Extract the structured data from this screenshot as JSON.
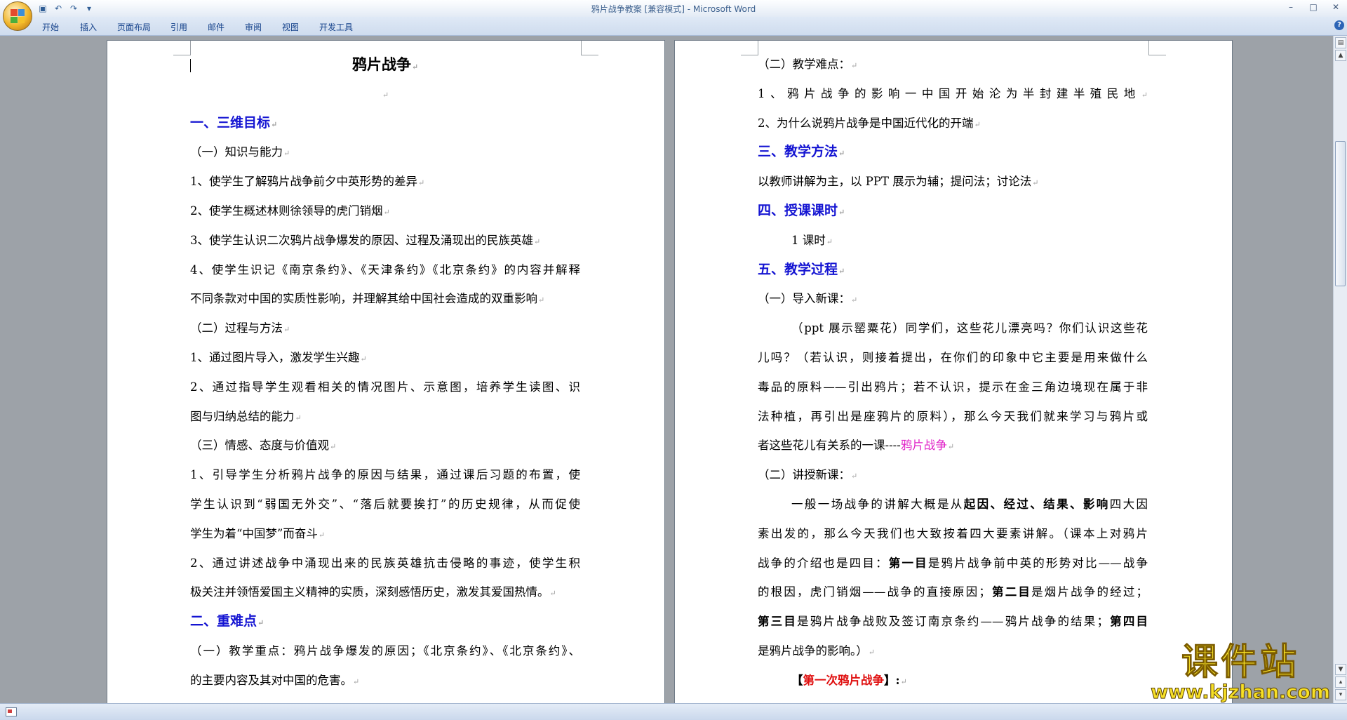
{
  "window": {
    "title": "鸦片战争教案 [兼容模式] - Microsoft Word",
    "controls": {
      "minimize": "–",
      "maximize": "□",
      "close": "✕"
    }
  },
  "qat": {
    "save_icon": "save-icon",
    "undo_icon": "undo-icon",
    "redo_icon": "redo-icon",
    "customize_icon": "chevron-down-icon"
  },
  "ribbon": {
    "tabs": [
      "开始",
      "插入",
      "页面布局",
      "引用",
      "邮件",
      "审阅",
      "视图",
      "开发工具"
    ],
    "help": "?"
  },
  "pilcrow": "↵",
  "page_left": {
    "lines": [
      {
        "text": "鸦片战争",
        "style": "title"
      },
      {
        "text": "",
        "style": "empty"
      },
      {
        "text": "一、三维目标",
        "style": "heading"
      },
      {
        "text": "（一）知识与能力",
        "style": "normal"
      },
      {
        "text": "1、使学生了解鸦片战争前夕中英形势的差异",
        "style": "normal"
      },
      {
        "text": "2、使学生概述林则徐领导的虎门销烟",
        "style": "normal"
      },
      {
        "text": "3、使学生认识二次鸦片战争爆发的原因、过程及涌现出的民族英雄",
        "style": "normal"
      },
      {
        "text": "4、使学生识记《南京条约》、《天津条约》《北京条约》的内容并解释",
        "style": "just"
      },
      {
        "text": "不同条款对中国的实质性影响，并理解其给中国社会造成的双重影响",
        "style": "normal"
      },
      {
        "text": "（二）过程与方法",
        "style": "normal"
      },
      {
        "text": "1、通过图片导入，激发学生兴趣",
        "style": "normal"
      },
      {
        "text": "2、通过指导学生观看相关的情况图片、示意图，培养学生读图、识",
        "style": "just"
      },
      {
        "text": "图与归纳总结的能力",
        "style": "normal"
      },
      {
        "text": "（三）情感、态度与价值观",
        "style": "normal"
      },
      {
        "text": "1、引导学生分析鸦片战争的原因与结果，通过课后习题的布置，使",
        "style": "just"
      },
      {
        "text": "学生认识到“弱国无外交”、“落后就要挨打”的历史规律，从而促使",
        "style": "just"
      },
      {
        "text": "学生为着“中国梦”而奋斗",
        "style": "normal"
      },
      {
        "text": "2、通过讲述战争中涌现出来的民族英雄抗击侵略的事迹，使学生积",
        "style": "just"
      },
      {
        "text": "极关注并领悟爱国主义精神的实质，深刻感悟历史，激发其爱国热情。",
        "style": "normal"
      },
      {
        "text": "二、重难点",
        "style": "heading"
      },
      {
        "text": "（一）教学重点：鸦片战争爆发的原因；《北京条约》、《北京条约》、",
        "style": "just"
      },
      {
        "text": "的主要内容及其对中国的危害。",
        "style": "normal"
      }
    ]
  },
  "page_right": {
    "l01": "（二）教学难点：",
    "l02": "1、鸦片战争的影响一中国开始沦为半封建半殖民地",
    "l03": "2、为什么说鸦片战争是中国近代化的开端",
    "l04": "三、教学方法",
    "l05": "以教师讲解为主，以 PPT 展示为辅；提问法；讨论法",
    "l06": "四、授课课时",
    "l07": "1 课时",
    "l08": "五、教学过程",
    "l09": "（一）导入新课：",
    "l10": "（ppt 展示罂粟花）同学们，这些花儿漂亮吗？你们认识这些花",
    "l11": "儿吗？（若认识，则接着提出，在你们的印象中它主要是用来做什么",
    "l12": "毒品的原料——引出鸦片；若不认识，提示在金三角边境现在属于非",
    "l13": "法种植，再引出是座鸦片的原料），那么今天我们就来学习与鸦片或",
    "l14a": "者这些花儿有关系的一课----",
    "l14b": "鸦片战争",
    "l15": "（二）讲授新课：",
    "l16a": "一般一场战争的讲解大概是从",
    "l16b": "起因、经过、结果、影响",
    "l16c": "四大因",
    "l17": "素出发的，那么今天我们也大致按着四大要素讲解。（课本上对鸦片",
    "l18a": "战争的介绍也是四目：",
    "l18b": "第一目",
    "l18c": "是鸦片战争前中英的形势对比——战争",
    "l19a": "的根因，虎门销烟——战争的直接原因；",
    "l19b": "第二目",
    "l19c": "是烟片战争的经过；",
    "l20a": "第三目",
    "l20b": "是鸦片战争战败及签订南京条约——鸦片战争的结果；",
    "l20c": "第四目",
    "l21": "是鸦片战争的影响。）",
    "l22a": "【",
    "l22b": "第一次鸦片战争",
    "l22c": "】:"
  },
  "watermark": {
    "brand": "课件站",
    "url": "www.kjzhan.com"
  },
  "colors": {
    "heading": "#1414d2",
    "highlight": "#e024c8",
    "red": "#e01010"
  }
}
